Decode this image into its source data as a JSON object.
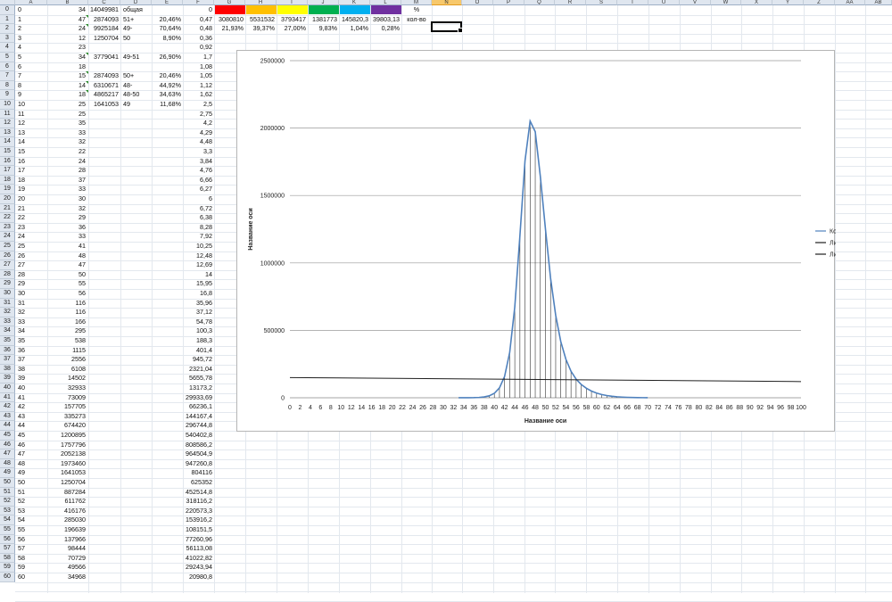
{
  "spreadsheet": {
    "columns": [
      "A",
      "B",
      "C",
      "D",
      "E",
      "F",
      "G",
      "H",
      "I",
      "J",
      "K",
      "L",
      "M",
      "N",
      "O",
      "P",
      "Q",
      "R",
      "S",
      "T",
      "U",
      "V",
      "W",
      "X",
      "Y",
      "Z",
      "AA",
      "AB"
    ],
    "selected_column": "N",
    "rows": [
      {
        "n": "0",
        "b": "34",
        "c": "14049981",
        "d": "общая",
        "e": "",
        "f": "0"
      },
      {
        "n": "1",
        "b": "47",
        "c": "2874093",
        "d": "51+",
        "e": "20,46%",
        "f": "0,47"
      },
      {
        "n": "2",
        "b": "24",
        "c": "9925184",
        "d": "49-",
        "e": "70,64%",
        "f": "0,48"
      },
      {
        "n": "3",
        "b": "12",
        "c": "1250704",
        "d": "50",
        "e": "8,90%",
        "f": "0,36"
      },
      {
        "n": "4",
        "b": "23",
        "c": "",
        "d": "",
        "e": "",
        "f": "0,92"
      },
      {
        "n": "5",
        "b": "34",
        "c": "3779041",
        "d": "49-51",
        "e": "26,90%",
        "f": "1,7"
      },
      {
        "n": "6",
        "b": "18",
        "c": "",
        "d": "",
        "e": "",
        "f": "1,08"
      },
      {
        "n": "7",
        "b": "15",
        "c": "2874093",
        "d": "50+",
        "e": "20,46%",
        "f": "1,05"
      },
      {
        "n": "8",
        "b": "14",
        "c": "6310671",
        "d": "48-",
        "e": "44,92%",
        "f": "1,12"
      },
      {
        "n": "9",
        "b": "18",
        "c": "4865217",
        "d": "48-50",
        "e": "34,63%",
        "f": "1,62"
      },
      {
        "n": "10",
        "b": "25",
        "c": "1641053",
        "d": "49",
        "e": "11,68%",
        "f": "2,5"
      },
      {
        "n": "11",
        "b": "25",
        "c": "",
        "d": "",
        "e": "",
        "f": "2,75"
      },
      {
        "n": "12",
        "b": "35",
        "c": "",
        "d": "",
        "e": "",
        "f": "4,2"
      },
      {
        "n": "13",
        "b": "33",
        "c": "",
        "d": "",
        "e": "",
        "f": "4,29"
      },
      {
        "n": "14",
        "b": "32",
        "c": "",
        "d": "",
        "e": "",
        "f": "4,48"
      },
      {
        "n": "15",
        "b": "22",
        "c": "",
        "d": "",
        "e": "",
        "f": "3,3"
      },
      {
        "n": "16",
        "b": "24",
        "c": "",
        "d": "",
        "e": "",
        "f": "3,84"
      },
      {
        "n": "17",
        "b": "28",
        "c": "",
        "d": "",
        "e": "",
        "f": "4,76"
      },
      {
        "n": "18",
        "b": "37",
        "c": "",
        "d": "",
        "e": "",
        "f": "6,66"
      },
      {
        "n": "19",
        "b": "33",
        "c": "",
        "d": "",
        "e": "",
        "f": "6,27"
      },
      {
        "n": "20",
        "b": "30",
        "c": "",
        "d": "",
        "e": "",
        "f": "6"
      },
      {
        "n": "21",
        "b": "32",
        "c": "",
        "d": "",
        "e": "",
        "f": "6,72"
      },
      {
        "n": "22",
        "b": "29",
        "c": "",
        "d": "",
        "e": "",
        "f": "6,38"
      },
      {
        "n": "23",
        "b": "36",
        "c": "",
        "d": "",
        "e": "",
        "f": "8,28"
      },
      {
        "n": "24",
        "b": "33",
        "c": "",
        "d": "",
        "e": "",
        "f": "7,92"
      },
      {
        "n": "25",
        "b": "41",
        "c": "",
        "d": "",
        "e": "",
        "f": "10,25"
      },
      {
        "n": "26",
        "b": "48",
        "c": "",
        "d": "",
        "e": "",
        "f": "12,48"
      },
      {
        "n": "27",
        "b": "47",
        "c": "",
        "d": "",
        "e": "",
        "f": "12,69"
      },
      {
        "n": "28",
        "b": "50",
        "c": "",
        "d": "",
        "e": "",
        "f": "14"
      },
      {
        "n": "29",
        "b": "55",
        "c": "",
        "d": "",
        "e": "",
        "f": "15,95"
      },
      {
        "n": "30",
        "b": "56",
        "c": "",
        "d": "",
        "e": "",
        "f": "16,8"
      },
      {
        "n": "31",
        "b": "116",
        "c": "",
        "d": "",
        "e": "",
        "f": "35,96"
      },
      {
        "n": "32",
        "b": "116",
        "c": "",
        "d": "",
        "e": "",
        "f": "37,12"
      },
      {
        "n": "33",
        "b": "166",
        "c": "",
        "d": "",
        "e": "",
        "f": "54,78"
      },
      {
        "n": "34",
        "b": "295",
        "c": "",
        "d": "",
        "e": "",
        "f": "100,3"
      },
      {
        "n": "35",
        "b": "538",
        "c": "",
        "d": "",
        "e": "",
        "f": "188,3"
      },
      {
        "n": "36",
        "b": "1115",
        "c": "",
        "d": "",
        "e": "",
        "f": "401,4"
      },
      {
        "n": "37",
        "b": "2556",
        "c": "",
        "d": "",
        "e": "",
        "f": "945,72"
      },
      {
        "n": "38",
        "b": "6108",
        "c": "",
        "d": "",
        "e": "",
        "f": "2321,04"
      },
      {
        "n": "39",
        "b": "14502",
        "c": "",
        "d": "",
        "e": "",
        "f": "5655,78"
      },
      {
        "n": "40",
        "b": "32933",
        "c": "",
        "d": "",
        "e": "",
        "f": "13173,2"
      },
      {
        "n": "41",
        "b": "73009",
        "c": "",
        "d": "",
        "e": "",
        "f": "29933,69"
      },
      {
        "n": "42",
        "b": "157705",
        "c": "",
        "d": "",
        "e": "",
        "f": "66236,1"
      },
      {
        "n": "43",
        "b": "335273",
        "c": "",
        "d": "",
        "e": "",
        "f": "144167,4"
      },
      {
        "n": "44",
        "b": "674420",
        "c": "",
        "d": "",
        "e": "",
        "f": "296744,8"
      },
      {
        "n": "45",
        "b": "1200895",
        "c": "",
        "d": "",
        "e": "",
        "f": "540402,8"
      },
      {
        "n": "46",
        "b": "1757796",
        "c": "",
        "d": "",
        "e": "",
        "f": "808586,2"
      },
      {
        "n": "47",
        "b": "2052138",
        "c": "",
        "d": "",
        "e": "",
        "f": "964504,9"
      },
      {
        "n": "48",
        "b": "1973460",
        "c": "",
        "d": "",
        "e": "",
        "f": "947260,8"
      },
      {
        "n": "49",
        "b": "1641053",
        "c": "",
        "d": "",
        "e": "",
        "f": "804116"
      },
      {
        "n": "50",
        "b": "1250704",
        "c": "",
        "d": "",
        "e": "",
        "f": "625352"
      },
      {
        "n": "51",
        "b": "887284",
        "c": "",
        "d": "",
        "e": "",
        "f": "452514,8"
      },
      {
        "n": "52",
        "b": "611762",
        "c": "",
        "d": "",
        "e": "",
        "f": "318116,2"
      },
      {
        "n": "53",
        "b": "416176",
        "c": "",
        "d": "",
        "e": "",
        "f": "220573,3"
      },
      {
        "n": "54",
        "b": "285030",
        "c": "",
        "d": "",
        "e": "",
        "f": "153916,2"
      },
      {
        "n": "55",
        "b": "196639",
        "c": "",
        "d": "",
        "e": "",
        "f": "108151,5"
      },
      {
        "n": "56",
        "b": "137966",
        "c": "",
        "d": "",
        "e": "",
        "f": "77260,96"
      },
      {
        "n": "57",
        "b": "98444",
        "c": "",
        "d": "",
        "e": "",
        "f": "56113,08"
      },
      {
        "n": "58",
        "b": "70729",
        "c": "",
        "d": "",
        "e": "",
        "f": "41022,82"
      },
      {
        "n": "59",
        "b": "49566",
        "c": "",
        "d": "",
        "e": "",
        "f": "29243,94"
      },
      {
        "n": "60",
        "b": "34968",
        "c": "",
        "d": "",
        "e": "",
        "f": "20980,8"
      }
    ],
    "flagged_rows": [
      "1",
      "2",
      "5",
      "7",
      "8",
      "9"
    ],
    "color_row": [
      {
        "color": "#ff0000"
      },
      {
        "color": "#ffc000"
      },
      {
        "color": "#ffff00"
      },
      {
        "color": "#00b050"
      },
      {
        "color": "#00b0f0"
      },
      {
        "color": "#7030a0"
      }
    ],
    "top_values_row1": [
      "3080810",
      "5531532",
      "3793417",
      "1381773",
      "145820,3",
      "39803,13"
    ],
    "top_values_row2": [
      "21,93%",
      "39,37%",
      "27,00%",
      "9,83%",
      "1,04%",
      "0,28%"
    ],
    "m_col_row0": "%",
    "m_col_row1": "кол-во"
  },
  "chart_data": {
    "type": "line",
    "title": "",
    "xlabel": "Название оси",
    "ylabel": "Название оси",
    "xlim": [
      0,
      100
    ],
    "ylim": [
      0,
      2500000
    ],
    "x_ticks": [
      "0",
      "2",
      "4",
      "6",
      "8",
      "10",
      "12",
      "14",
      "16",
      "18",
      "20",
      "22",
      "24",
      "26",
      "28",
      "30",
      "32",
      "34",
      "36",
      "38",
      "40",
      "42",
      "44",
      "46",
      "48",
      "50",
      "52",
      "54",
      "56",
      "58",
      "60",
      "62",
      "64",
      "66",
      "68",
      "70",
      "72",
      "74",
      "76",
      "78",
      "80",
      "82",
      "84",
      "86",
      "88",
      "90",
      "92",
      "94",
      "96",
      "98",
      "100"
    ],
    "y_ticks": [
      "0",
      "500000",
      "1000000",
      "1500000",
      "2000000",
      "2500000"
    ],
    "grid": true,
    "legend_position": "right",
    "series": [
      {
        "name": "Кол-во",
        "color": "#4f81bd",
        "x": [
          33,
          34,
          35,
          36,
          37,
          38,
          39,
          40,
          41,
          42,
          43,
          44,
          45,
          46,
          47,
          48,
          49,
          50,
          51,
          52,
          53,
          54,
          55,
          56,
          57,
          58,
          59,
          60,
          61,
          62,
          63,
          64,
          65,
          66,
          67,
          68,
          69,
          70
        ],
        "y": [
          166,
          295,
          538,
          1115,
          2556,
          6108,
          14502,
          32933,
          73009,
          157705,
          335273,
          674420,
          1200895,
          1757796,
          2052138,
          1973460,
          1641053,
          1250704,
          887284,
          611762,
          416176,
          285030,
          196639,
          137966,
          98444,
          70729,
          49566,
          34968,
          24000,
          16500,
          11200,
          7500,
          5000,
          3300,
          2100,
          1300,
          800,
          500
        ]
      },
      {
        "name": "Линейная (Кол-во)",
        "color": "#1f1f1f",
        "x": [
          0,
          100
        ],
        "y": [
          150000,
          120000
        ]
      },
      {
        "name": "Линейная (Кол-во)",
        "color": "#1f1f1f",
        "x": [],
        "y": []
      }
    ]
  }
}
